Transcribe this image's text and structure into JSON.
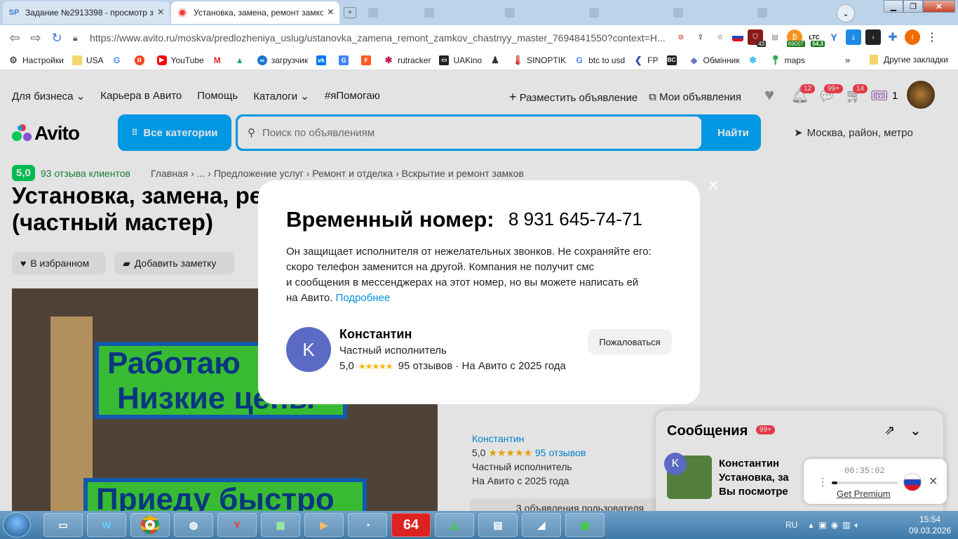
{
  "browser": {
    "tabs": [
      {
        "favicon": "SP",
        "title": "Задание №2913398 - просмотр з",
        "active": false
      },
      {
        "favicon": "avito-icon",
        "title": "Установка, замена, ремонт замко",
        "active": true
      }
    ],
    "url": "https://www.avito.ru/moskva/predlozheniya_uslug/ustanovka_zamena_remont_zamkov_chastnyy_master_7694841550?context=H...",
    "extensions": [
      {
        "name": "translate-icon",
        "label": ""
      },
      {
        "name": "share-icon",
        "label": ""
      },
      {
        "name": "star-icon",
        "label": ""
      },
      {
        "name": "flag-ru-icon",
        "label": ""
      },
      {
        "name": "shield-ext-icon",
        "label": "43"
      },
      {
        "name": "printer-ext-icon",
        "label": ""
      },
      {
        "name": "btc-ext-icon",
        "label": "69007"
      },
      {
        "name": "ltc-ext-icon",
        "label": "54.3"
      },
      {
        "name": "y-ext-icon",
        "label": ""
      },
      {
        "name": "download-ext-icon",
        "label": ""
      },
      {
        "name": "terminal-ext-icon",
        "label": ""
      },
      {
        "name": "puzzle-icon",
        "label": ""
      },
      {
        "name": "profile-icon",
        "label": "I"
      }
    ],
    "bookmarks": [
      {
        "icon": "gear-icon",
        "label": "Настройки"
      },
      {
        "icon": "folder-icon",
        "label": "USA"
      },
      {
        "icon": "google-icon",
        "label": ""
      },
      {
        "icon": "yandex-icon",
        "label": ""
      },
      {
        "icon": "youtube-icon",
        "label": "YouTube"
      },
      {
        "icon": "gmail-icon",
        "label": ""
      },
      {
        "icon": "drive-icon",
        "label": ""
      },
      {
        "icon": "infinity-icon",
        "label": "загрузчик"
      },
      {
        "icon": "vk-icon",
        "label": ""
      },
      {
        "icon": "translate-icon",
        "label": ""
      },
      {
        "icon": "f-icon",
        "label": ""
      },
      {
        "icon": "rutracker-icon",
        "label": "rutracker"
      },
      {
        "icon": "uakino-icon",
        "label": "UAKino"
      },
      {
        "icon": "figure-icon",
        "label": ""
      },
      {
        "icon": "thermometer-icon",
        "label": "SINOPTIK"
      },
      {
        "icon": "google-icon",
        "label": "btc to usd"
      },
      {
        "icon": "fp-icon",
        "label": "FP"
      },
      {
        "icon": "bc-icon",
        "label": ""
      },
      {
        "icon": "exchange-icon",
        "label": "Обмінник"
      },
      {
        "icon": "snowflake-icon",
        "label": ""
      },
      {
        "icon": "maps-icon",
        "label": "maps"
      }
    ],
    "more_label": "»",
    "other_bookmarks": "Другие закладки"
  },
  "header": {
    "nav": [
      "Для бизнеса",
      "Карьера в Авито",
      "Помощь",
      "Каталоги",
      "#яПомогаю"
    ],
    "post_ad": "Разместить объявление",
    "my_ads": "Мои объявления",
    "notifications_count": "12",
    "messages_count": "99+",
    "cart_count": "14",
    "coupons_count": "1",
    "logo": "Avito",
    "all_categories": "Все категории",
    "search_placeholder": "Поиск по объявлениям",
    "search_button": "Найти",
    "location": "Москва, район, метро"
  },
  "listing": {
    "rating": "5,0",
    "reviews_link": "93 отзыва клиентов",
    "breadcrumbs": "Главная › ... › Предложение услуг › Ремонт и отделка › Вскрытие и ремонт замков",
    "title_line1": "Установка, замена, ре",
    "title_line2": "(частный мастер)",
    "favorite": "В избранном",
    "add_note": "Добавить заметку",
    "photo_text1": "Работаю",
    "photo_text2": "Низкие цены",
    "photo_text3": "Приеду быстро",
    "seller_name": "Константин",
    "seller_rating": "5,0",
    "seller_reviews": "95 отзывов",
    "seller_role": "Частный исполнитель",
    "seller_since": "На Авито с 2025 года",
    "more_ads": "3 объявления пользователя"
  },
  "messenger": {
    "title": "Сообщения",
    "badge": "99+",
    "chat_name": "Константин",
    "chat_subject": "Установка, за",
    "chat_preview": "Вы посмотре",
    "avatar_letter": "K"
  },
  "modal": {
    "title": "Временный номер:",
    "phone": "8 931 645-74-71",
    "text_line1": "Он защищает исполнителя от нежелательных звонков. Не сохраняйте его:",
    "text_line2": "скоро телефон заменится на другой. Компания не получит смс",
    "text_line3": "и сообщения в мессенджерах на этот номер, но вы можете написать ей",
    "text_line4": "на Авито.",
    "more_link": "Подробнее",
    "avatar_letter": "K",
    "name": "Константин",
    "role": "Частный исполнитель",
    "rating": "5,0",
    "reviews": "95 отзывов",
    "since": "· На Авито с 2025 года",
    "complain": "Пожаловаться"
  },
  "player": {
    "time": "00:35:02",
    "premium": "Get Premium",
    "progress": 0.08
  },
  "taskbar": {
    "lang": "RU",
    "time": "15:54",
    "date": "09.03.2026",
    "apps": [
      "explorer-icon",
      "malwarebytes-icon",
      "chrome-icon",
      "globe-icon",
      "yandex-browser-icon",
      "money-app-icon",
      "media-player-icon",
      "clock-app-icon",
      "64-app-icon",
      "chart-app-icon",
      "calculator-icon",
      "notes-icon",
      "monitor-icon"
    ],
    "app_64": "64"
  },
  "colors": {
    "avito_blue": "#00aaff",
    "rating_green": "#02d15c",
    "badge_red": "#ff4053",
    "link": "#0091e0",
    "avatar": "#5b6ac4"
  }
}
